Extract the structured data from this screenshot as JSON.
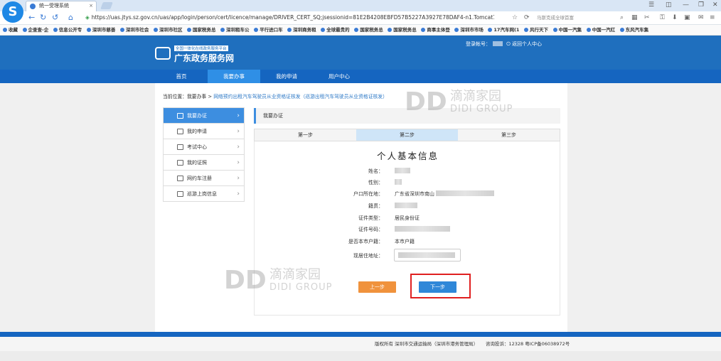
{
  "browser": {
    "tab_title": "统一受理系统",
    "tab_close": "×",
    "url": "https://uas.jtys.sz.gov.cn/uas/app/login/person/cert/licence/manage/DRIVER_CERT_SQ;jsessionid=81E2B4208EBFD57B5227A3927E78DAF4-n1.Tomcat1#",
    "search_placeholder": "马斯克成全球首富",
    "bookmarks": [
      "收藏",
      "企查查-企",
      "信息公开专",
      "深圳市慈善",
      "深圳市社会",
      "深圳市社区",
      "国家税务总",
      "深圳租车公",
      "平行进口车",
      "深圳商务租",
      "全球最贵的",
      "国家税务总",
      "国家税务总",
      "商事主体登",
      "深圳市市场",
      "17汽车网(1",
      "风行天下",
      "中国一汽集",
      "中国一汽红",
      "东风汽车集"
    ]
  },
  "header": {
    "platform_sub": "全国一体化在线政务服务平台",
    "platform_name": "广东政务服务网",
    "login_label": "登录帐号：",
    "back_label": "返回个人中心"
  },
  "menu": [
    "首页",
    "我要办事",
    "我的申请",
    "用户中心"
  ],
  "breadcrumb": {
    "prefix": "当前位置：我要办事 >",
    "link": "网络预约出租汽车驾驶员从业资格证核发（巡游出租汽车驾驶员从业资格证核发）"
  },
  "sidebar": [
    {
      "label": "我要办证",
      "icon": "user-icon"
    },
    {
      "label": "我的申请",
      "icon": "edit-icon"
    },
    {
      "label": "考试中心",
      "icon": "exam-icon"
    },
    {
      "label": "我的证照",
      "icon": "certificate-icon"
    },
    {
      "label": "网约车注册",
      "icon": "car-icon"
    },
    {
      "label": "巡游上岗信息",
      "icon": "id-card-icon"
    }
  ],
  "panel_title": "我要办证",
  "steps": [
    "第一步",
    "第二步",
    "第三步"
  ],
  "form": {
    "title": "个人基本信息",
    "labels": [
      "姓名：",
      "性别：",
      "户口所在地：",
      "籍贯：",
      "证件类型：",
      "证件号码：",
      "是否本市户籍：",
      "现居住地址："
    ],
    "hukou_value": "广东省深圳市南山",
    "id_type_value": "居民身份证",
    "local_value": "本市户籍"
  },
  "buttons": {
    "prev": "上一步",
    "next": "下一步"
  },
  "watermark": {
    "logo": "DD",
    "cn": "滴滴家园",
    "en": "DIDI GROUP"
  },
  "footer": {
    "copyright": "版权所有  深圳市交通运输局（深圳市港务管理局）",
    "hotline": "咨询投诉：12328  粤ICP备06038972号"
  },
  "colors": {
    "header_blue": "#1f6fbe",
    "menu_blue": "#1565c0",
    "active_blue": "#3d8ee0",
    "highlight_red": "#e02020",
    "prev_orange": "#f0923c"
  }
}
